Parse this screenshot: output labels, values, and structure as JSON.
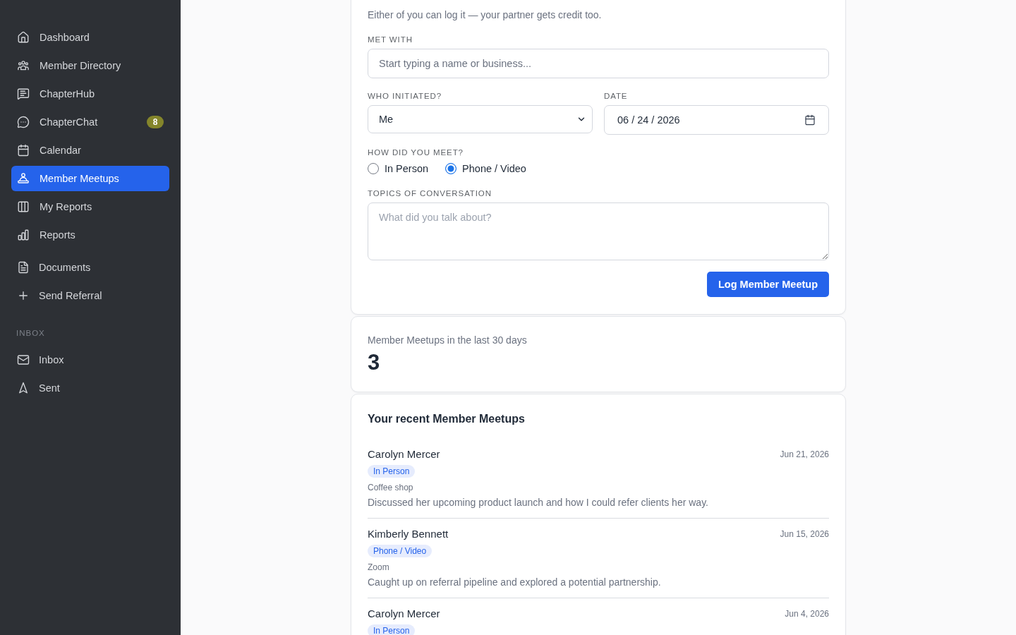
{
  "sidebar": {
    "nav": [
      {
        "label": "Dashboard",
        "selected": false
      },
      {
        "label": "Member Directory",
        "selected": false
      },
      {
        "label": "ChapterHub",
        "selected": false
      },
      {
        "label": "ChapterChat",
        "selected": false,
        "badge": "8"
      },
      {
        "label": "Calendar",
        "selected": false
      },
      {
        "label": "Member Meetups",
        "selected": true
      },
      {
        "label": "My Reports",
        "selected": false
      },
      {
        "label": "Reports",
        "selected": false
      }
    ],
    "actions": [
      {
        "label": "Documents",
        "selected": false
      },
      {
        "label": "Send Referral",
        "selected": false
      }
    ],
    "inbox": {
      "heading": "INBOX",
      "items": [
        {
          "label": "Inbox",
          "selected": false
        },
        {
          "label": "Sent",
          "selected": false
        }
      ]
    }
  },
  "form": {
    "subtitle": "Either of you can log it — your partner gets credit too.",
    "met_with": {
      "label": "MET WITH",
      "placeholder": "Start typing a name or business..."
    },
    "initiated": {
      "label": "WHO INITIATED?",
      "value": "Me"
    },
    "date": {
      "label": "DATE",
      "value": "06 / 24 / 2026"
    },
    "method": {
      "label": "HOW DID YOU MEET?",
      "options": [
        {
          "label": "In Person",
          "selected": false
        },
        {
          "label": "Phone / Video",
          "selected": true
        }
      ]
    },
    "topics": {
      "label": "TOPICS OF CONVERSATION",
      "placeholder": "What did you talk about?"
    },
    "submit": "Log Member Meetup"
  },
  "stats": {
    "label": "Member Meetups in the last 30 days",
    "value": "3"
  },
  "recent": {
    "title": "Your recent Member Meetups",
    "entries": [
      {
        "name": "Carolyn Mercer",
        "date": "Jun 21, 2026",
        "method": "In Person",
        "place": "Coffee shop",
        "notes": "Discussed her upcoming product launch and how I could refer clients her way."
      },
      {
        "name": "Kimberly Bennett",
        "date": "Jun 15, 2026",
        "method": "Phone / Video",
        "place": "Zoom",
        "notes": "Caught up on referral pipeline and explored a potential partnership."
      },
      {
        "name": "Carolyn Mercer",
        "date": "Jun 4, 2026",
        "method": "In Person"
      }
    ]
  }
}
